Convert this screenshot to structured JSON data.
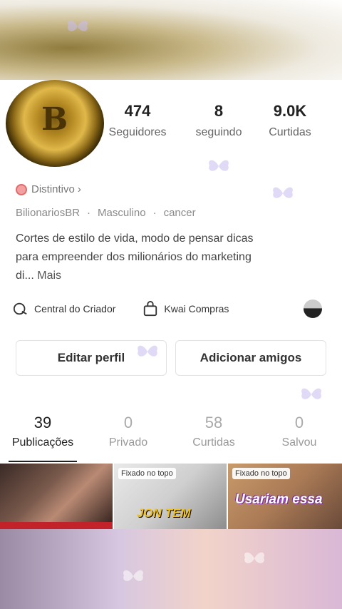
{
  "stats": {
    "followers": {
      "value": "474",
      "label": "Seguidores"
    },
    "following": {
      "value": "8",
      "label": "seguindo"
    },
    "likes": {
      "value": "9.0K",
      "label": "Curtidas"
    }
  },
  "badge": {
    "label": "Distintivo",
    "chevron": "›"
  },
  "meta": {
    "name": "BilionariosBR",
    "gender": "Masculino",
    "sign": "cancer",
    "sep": "·"
  },
  "bio": {
    "text": "Cortes de estilo de vida, modo de pensar dicas para empreender dos milionários do marketing di...",
    "more": "Mais"
  },
  "tools": {
    "creator": "Central do Criador",
    "shop": "Kwai Compras"
  },
  "buttons": {
    "edit": "Editar perfil",
    "add_friends": "Adicionar amigos"
  },
  "tabs": [
    {
      "count": "39",
      "label": "Publicações"
    },
    {
      "count": "0",
      "label": "Privado"
    },
    {
      "count": "58",
      "label": "Curtidas"
    },
    {
      "count": "0",
      "label": "Salvou"
    }
  ],
  "thumbnails": [
    {
      "pinned": ""
    },
    {
      "pinned": "Fixado no topo",
      "caption": "JON TEM"
    },
    {
      "pinned": "Fixado no topo",
      "caption": "Usariam essa"
    }
  ],
  "icons": [
    "creator-center-icon",
    "shopping-bag-icon",
    "badge-icon",
    "butterfly-icon"
  ]
}
